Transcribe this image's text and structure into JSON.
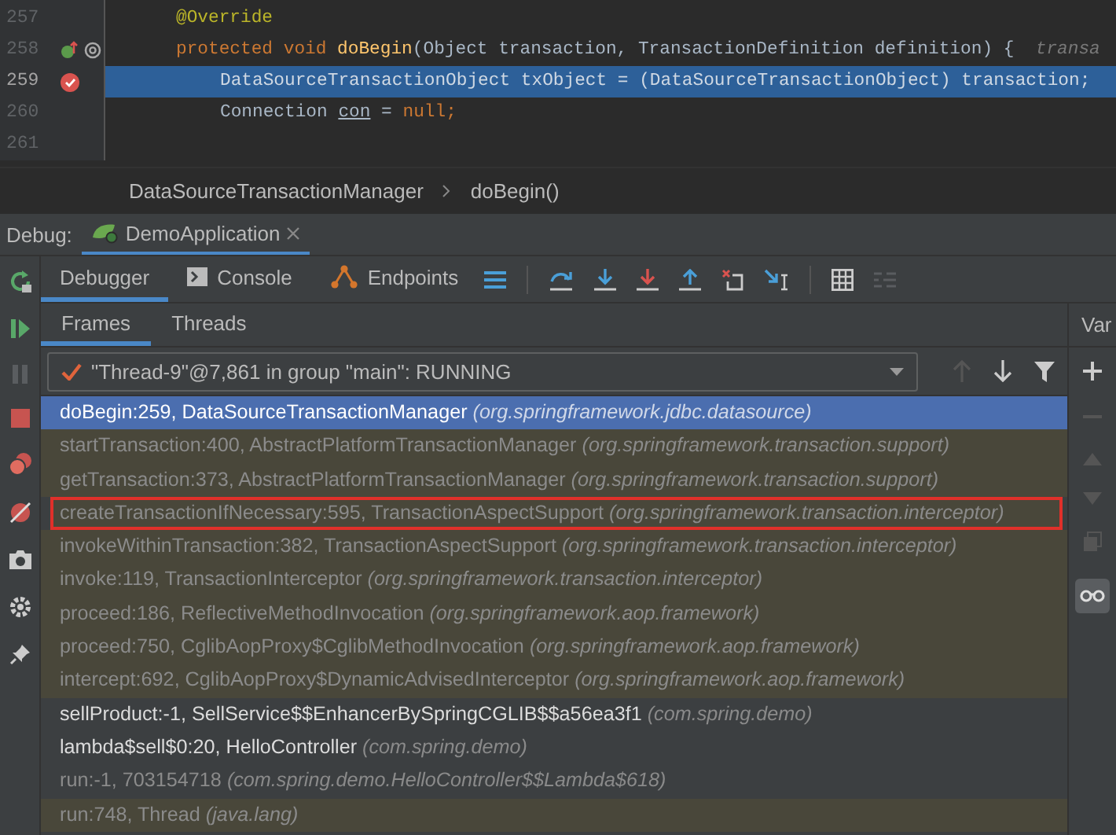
{
  "editor": {
    "lines": [
      {
        "number": "257",
        "current": false,
        "tokens": [
          {
            "text": "@Override",
            "kind": "annotation"
          }
        ]
      },
      {
        "number": "258",
        "current": false,
        "tokens": [
          {
            "text": "protected void ",
            "kind": "keyword"
          },
          {
            "text": "doBegin",
            "kind": "method"
          },
          {
            "text": "(Object transaction, TransactionDefinition definition) {",
            "kind": "plain"
          },
          {
            "text": "  transa",
            "kind": "hint"
          }
        ]
      },
      {
        "number": "259",
        "current": true,
        "tokens": [
          {
            "text": "DataSourceTransactionObject txObject = (DataSourceTransactionObject) transaction;",
            "kind": "plain"
          }
        ]
      },
      {
        "number": "260",
        "current": false,
        "tokens": [
          {
            "text": "Connection ",
            "kind": "plain"
          },
          {
            "text": "con",
            "kind": "underline"
          },
          {
            "text": " = ",
            "kind": "plain"
          },
          {
            "text": "null",
            "kind": "keyword"
          },
          {
            "text": ";",
            "kind": "keyword"
          }
        ]
      },
      {
        "number": "261",
        "current": false
      }
    ],
    "breadcrumb": [
      "DataSourceTransactionManager",
      "doBegin()"
    ]
  },
  "debug": {
    "label": "Debug:",
    "session": "DemoApplication",
    "tabs": [
      {
        "label": "Debugger",
        "selected": true
      },
      {
        "label": "Console",
        "selected": false
      },
      {
        "label": "Endpoints",
        "selected": false
      }
    ],
    "subtabs": [
      {
        "label": "Frames",
        "selected": true
      },
      {
        "label": "Threads",
        "selected": false
      }
    ],
    "thread": "\"Thread-9\"@7,861 in group \"main\": RUNNING",
    "variables_header": "Var",
    "frames": [
      {
        "method": "doBegin:259, DataSourceTransactionManager",
        "package": "(org.springframework.jdbc.datasource)",
        "kind": "selected",
        "outlined": false
      },
      {
        "method": "startTransaction:400, AbstractPlatformTransactionManager",
        "package": "(org.springframework.transaction.support)",
        "kind": "library",
        "outlined": false
      },
      {
        "method": "getTransaction:373, AbstractPlatformTransactionManager",
        "package": "(org.springframework.transaction.support)",
        "kind": "library",
        "outlined": false
      },
      {
        "method": "createTransactionIfNecessary:595, TransactionAspectSupport",
        "package": "(org.springframework.transaction.interceptor)",
        "kind": "library",
        "outlined": true
      },
      {
        "method": "invokeWithinTransaction:382, TransactionAspectSupport",
        "package": "(org.springframework.transaction.interceptor)",
        "kind": "library",
        "outlined": false
      },
      {
        "method": "invoke:119, TransactionInterceptor",
        "package": "(org.springframework.transaction.interceptor)",
        "kind": "library",
        "outlined": false
      },
      {
        "method": "proceed:186, ReflectiveMethodInvocation",
        "package": "(org.springframework.aop.framework)",
        "kind": "library",
        "outlined": false
      },
      {
        "method": "proceed:750, CglibAopProxy$CglibMethodInvocation",
        "package": "(org.springframework.aop.framework)",
        "kind": "library",
        "outlined": false
      },
      {
        "method": "intercept:692, CglibAopProxy$DynamicAdvisedInterceptor",
        "package": "(org.springframework.aop.framework)",
        "kind": "library",
        "outlined": false
      },
      {
        "method": "sellProduct:-1, SellService$$EnhancerBySpringCGLIB$$a56ea3f1",
        "package": "(com.spring.demo)",
        "kind": "user",
        "outlined": false
      },
      {
        "method": "lambda$sell$0:20, HelloController",
        "package": "(com.spring.demo)",
        "kind": "user",
        "outlined": false
      },
      {
        "method": "run:-1, 703154718",
        "package": "(com.spring.demo.HelloController$$Lambda$618)",
        "kind": "synthetic",
        "outlined": false
      },
      {
        "method": "run:748, Thread",
        "package": "(java.lang)",
        "kind": "library",
        "outlined": false
      }
    ]
  }
}
